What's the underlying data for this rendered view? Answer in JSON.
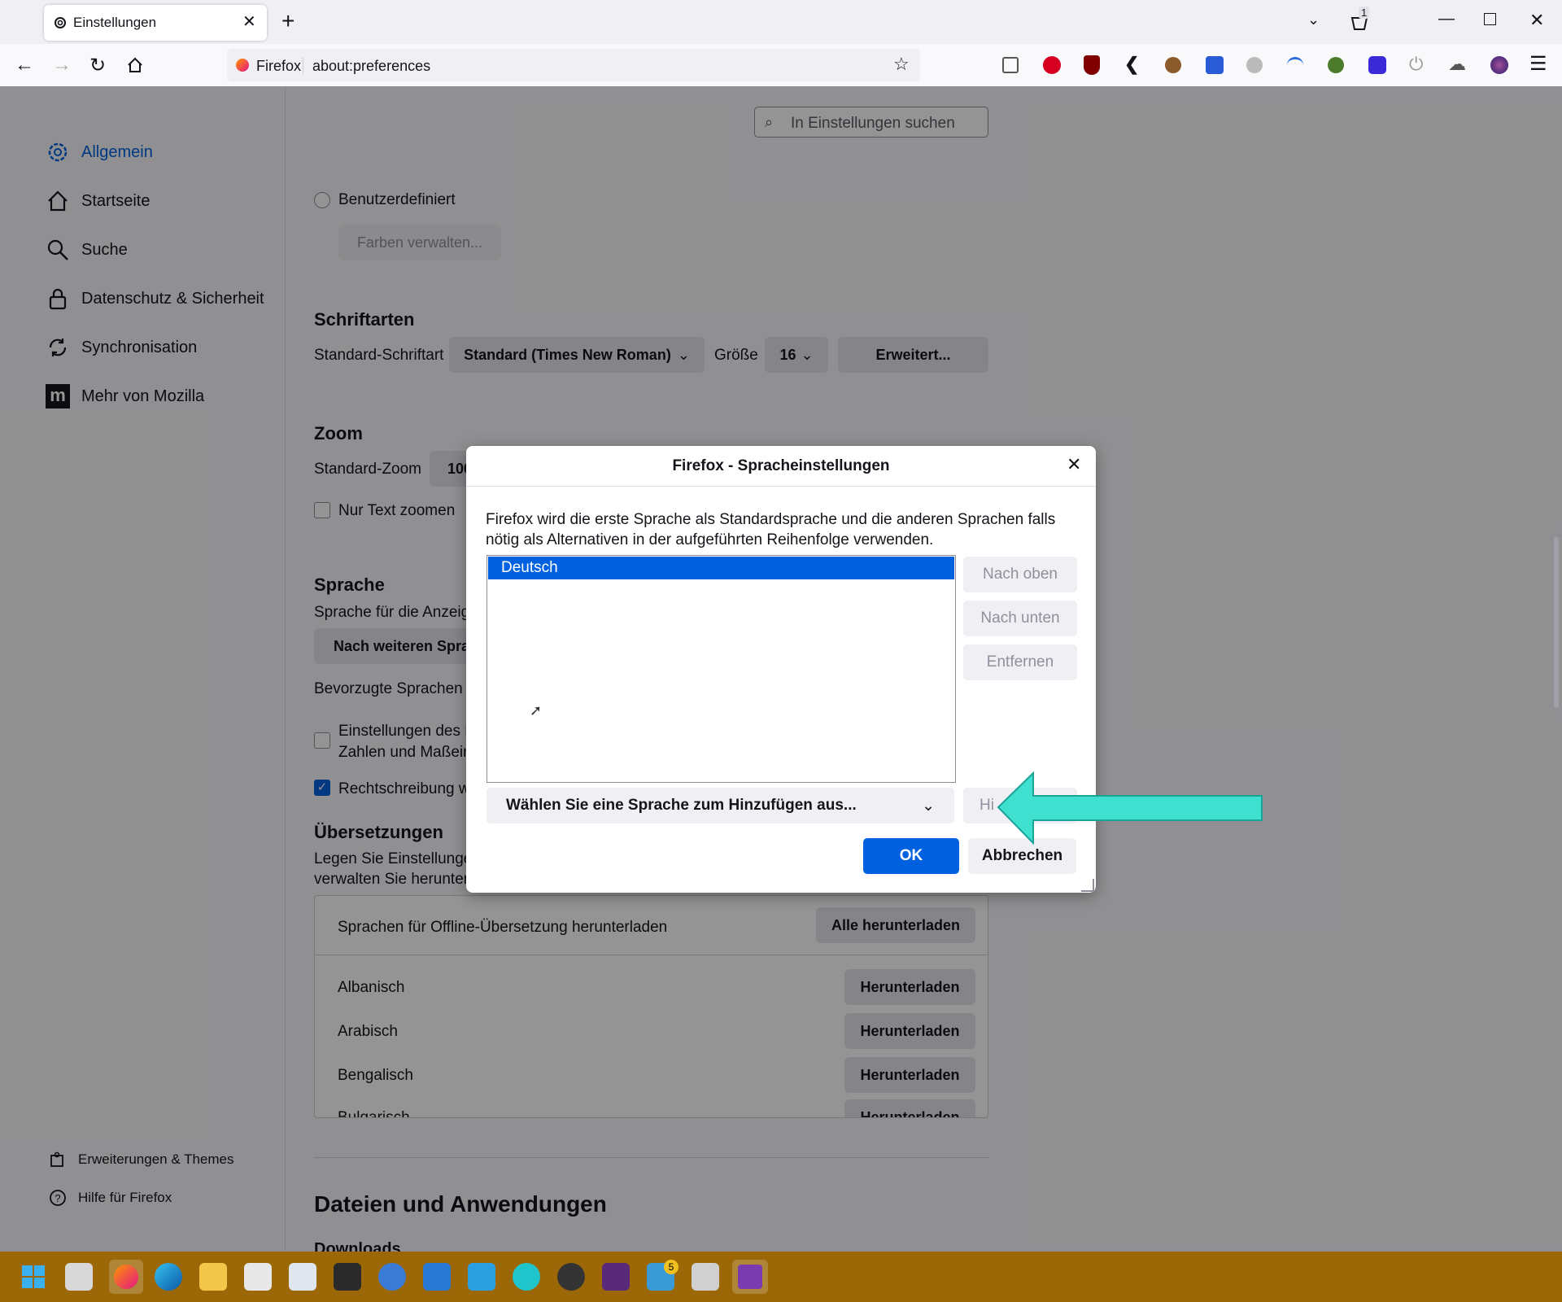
{
  "browser": {
    "tab_title": "Einstellungen",
    "identity_label": "Firefox",
    "url": "about:preferences",
    "notification_count": "1",
    "accent_color": "#0061e0"
  },
  "sidebar": {
    "items": [
      {
        "label": "Allgemein",
        "icon": "gear-icon",
        "active": true
      },
      {
        "label": "Startseite",
        "icon": "home-icon"
      },
      {
        "label": "Suche",
        "icon": "search-icon"
      },
      {
        "label": "Datenschutz & Sicherheit",
        "icon": "lock-icon"
      },
      {
        "label": "Synchronisation",
        "icon": "sync-icon"
      },
      {
        "label": "Mehr von Mozilla",
        "icon": "mozilla-icon"
      }
    ],
    "footer": [
      {
        "label": "Erweiterungen & Themes",
        "icon": "puzzle-icon"
      },
      {
        "label": "Hilfe für Firefox",
        "icon": "help-icon"
      }
    ]
  },
  "search": {
    "placeholder": "In Einstellungen suchen"
  },
  "colors_section": {
    "custom_label": "Benutzerdefiniert",
    "manage_colors_button": "Farben verwalten..."
  },
  "fonts": {
    "heading": "Schriftarten",
    "default_font_label": "Standard-Schriftart",
    "default_font_value": "Standard (Times New Roman)",
    "size_label": "Größe",
    "size_value": "16",
    "advanced_button": "Erweitert..."
  },
  "zoom": {
    "heading": "Zoom",
    "default_zoom_label": "Standard-Zoom",
    "default_zoom_value": "100",
    "text_only_label": "Nur Text zoomen"
  },
  "language": {
    "heading": "Sprache",
    "display_text": "Sprache für die Anzeig",
    "more_languages_button": "Nach weiteren Spra",
    "preferred_text": "Bevorzugte Sprachen f",
    "regional_line1": "Einstellungen des B",
    "regional_line2": "Zahlen und Maßein",
    "spellcheck_label": "Rechtschreibung w"
  },
  "translations": {
    "heading": "Übersetzungen",
    "desc_line1": "Legen Sie Einstellunger",
    "desc_line2": "verwalten Sie herunter",
    "offline_label": "Sprachen für Offline-Übersetzung herunterladen",
    "download_all_button": "Alle herunterladen",
    "download_button": "Herunterladen",
    "languages": [
      "Albanisch",
      "Arabisch",
      "Bengalisch",
      "Bulgarisch"
    ]
  },
  "files": {
    "heading": "Dateien und Anwendungen",
    "downloads": "Downloads"
  },
  "dialog": {
    "title": "Firefox - Spracheinstellungen",
    "description": "Firefox wird die erste Sprache als Standardsprache und die anderen Sprachen falls nötig als Alternativen in der aufgeführten Reihenfolge verwenden.",
    "languages": [
      "Deutsch"
    ],
    "move_up": "Nach oben",
    "move_down": "Nach unten",
    "remove": "Entfernen",
    "select_placeholder": "Wählen Sie eine Sprache zum Hinzufügen aus...",
    "add_button": "Hi",
    "ok": "OK",
    "cancel": "Abbrechen"
  },
  "annotation": {
    "arrow_color": "#40e0d0"
  },
  "taskbar": {
    "badge": "5"
  }
}
